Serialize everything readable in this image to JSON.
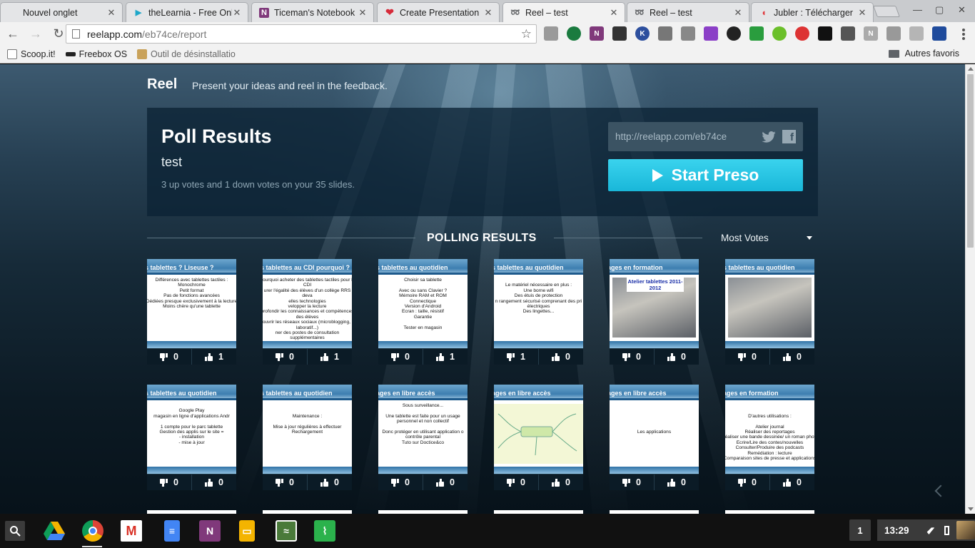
{
  "browser": {
    "tabs": [
      {
        "title": "Nouvel onglet",
        "favicon": "blank-page-icon",
        "color": "#e4e5e7"
      },
      {
        "title": "theLearnia - Free Onl",
        "favicon": "thelearnia-icon",
        "color": "#1ea7c9"
      },
      {
        "title": "Ticeman's Notebook",
        "favicon": "onenote-icon",
        "color": "#80397b"
      },
      {
        "title": "Create Presentation",
        "favicon": "heart-icon",
        "color": "#d62b3a"
      },
      {
        "title": "Reel – test",
        "favicon": "reel-icon",
        "color": "#1c94bd"
      },
      {
        "title": "Reel – test",
        "favicon": "reel-icon",
        "color": "#1c94bd"
      },
      {
        "title": "Jubler : Télécharger",
        "favicon": "jubler-icon",
        "color": "#e0383c"
      }
    ],
    "address": {
      "host": "reelapp.com",
      "path": "/eb74ce/report"
    },
    "bookmarks": [
      "Scoop.it!",
      "Freebox OS",
      "Outil de désinstallatio"
    ],
    "other_bookmarks": "Autres favoris"
  },
  "page": {
    "brand": "Reel",
    "tagline": "Present your ideas and reel in the feedback.",
    "poll_title": "Poll Results",
    "poll_name": "test",
    "summary": "3 up votes and 1 down votes on your 35 slides.",
    "share_url": "http://reelapp.com/eb74ce",
    "start_button": "Start Preso",
    "section_title": "POLLING RESULTS",
    "sort": "Most Votes",
    "accent": "#22c2e2"
  },
  "slides": [
    {
      "title": "es tablettes ? Liseuse ?",
      "body": "Différences avec tablettes tactiles :\nMonochrome\nPetit format\nPas de fonctions avancées\nDédiées presque exclusivement à la lecture\nMoins chère qu'une tablette",
      "down": "0",
      "up": "1"
    },
    {
      "title": "es tablettes au CDI pourquoi ?",
      "body": "Pourquoi acheter des tablettes tactiles pour le CDI\nurer l'égalité des élèves d'un collège RRS deva\nelles technologies\nvelopper la lecture\nprofondir les connaissances et compétences des élèves\ncouvrir les réseaux sociaux (microblogging, é\nlaboratif...)\nner des postes de consultation supplémentaires\n(recherche internet, lecture presse...)",
      "down": "0",
      "up": "1"
    },
    {
      "title": "es tablettes au quotidien",
      "body": "Choisir sa tablette\n\nAvec ou sans Clavier ?\nMémoire RAM et ROM\nConnectique\nVersion d'Android\nEcran : taille, résistif\nGarantie\n\nTester en magasin",
      "down": "0",
      "up": "1"
    },
    {
      "title": "es tablettes au quotidien",
      "body": "\nLe matériel nécessaire en plus :\nUne borne wifi\nDes étuis de protection\nn rangement sécurisé comprenant des pri\nélectriques\nDes lingettes...",
      "down": "1",
      "up": "0"
    },
    {
      "title": "sages en formation",
      "body": "Atelier tablettes 2011-2012",
      "kind": "photo",
      "down": "0",
      "up": "0"
    },
    {
      "title": "es tablettes au quotidien",
      "body": "",
      "kind": "photo",
      "down": "0",
      "up": "0"
    },
    {
      "title": "es tablettes au quotidien",
      "body": "\nGoogle Play\nmagasin en ligne d'applications Andr\n\n1 compte pour le parc tablette\nGestion des applis sur le site =\n- installation\n- mise à jour",
      "down": "0",
      "up": "0"
    },
    {
      "title": "es tablettes au quotidien",
      "body": "\n\nMaintenance :\n\nMise à jour régulières à effectuer\nRechargement",
      "down": "0",
      "up": "0"
    },
    {
      "title": "sages en libre accès",
      "body": "Sous surveillance...\n\nUne tablette est faite pour un usage\npersonnel et non collectif\n\nDonc protéger en utilisant application o\ncontrôle parental\nTuto sur Doctice&co",
      "down": "0",
      "up": "0"
    },
    {
      "title": "sages en libre accès",
      "body": "",
      "kind": "mindmap",
      "down": "0",
      "up": "0"
    },
    {
      "title": "sages en libre accès",
      "body": "\n\n\n\n\nLes applications",
      "down": "0",
      "up": "0"
    },
    {
      "title": "sages en formation",
      "body": "\n\nD'autres utilisations :\n\nAtelier journal\nRéaliser des reportages\nRéaliser une bande dessinée/ un roman photo\nEcrire/Lire des contes/nouvelles\nConsulter/Produire des podcasts\nRemédiation : lecture\nComparaison sites de presse et applications",
      "down": "0",
      "up": "0"
    }
  ],
  "shelf": {
    "apps": [
      "drive-icon",
      "chrome-icon",
      "gmail-icon",
      "docs-icon",
      "onenote-icon",
      "slides-icon",
      "map-icon",
      "feedly-icon"
    ],
    "notifications": "1",
    "time": "13:29"
  }
}
